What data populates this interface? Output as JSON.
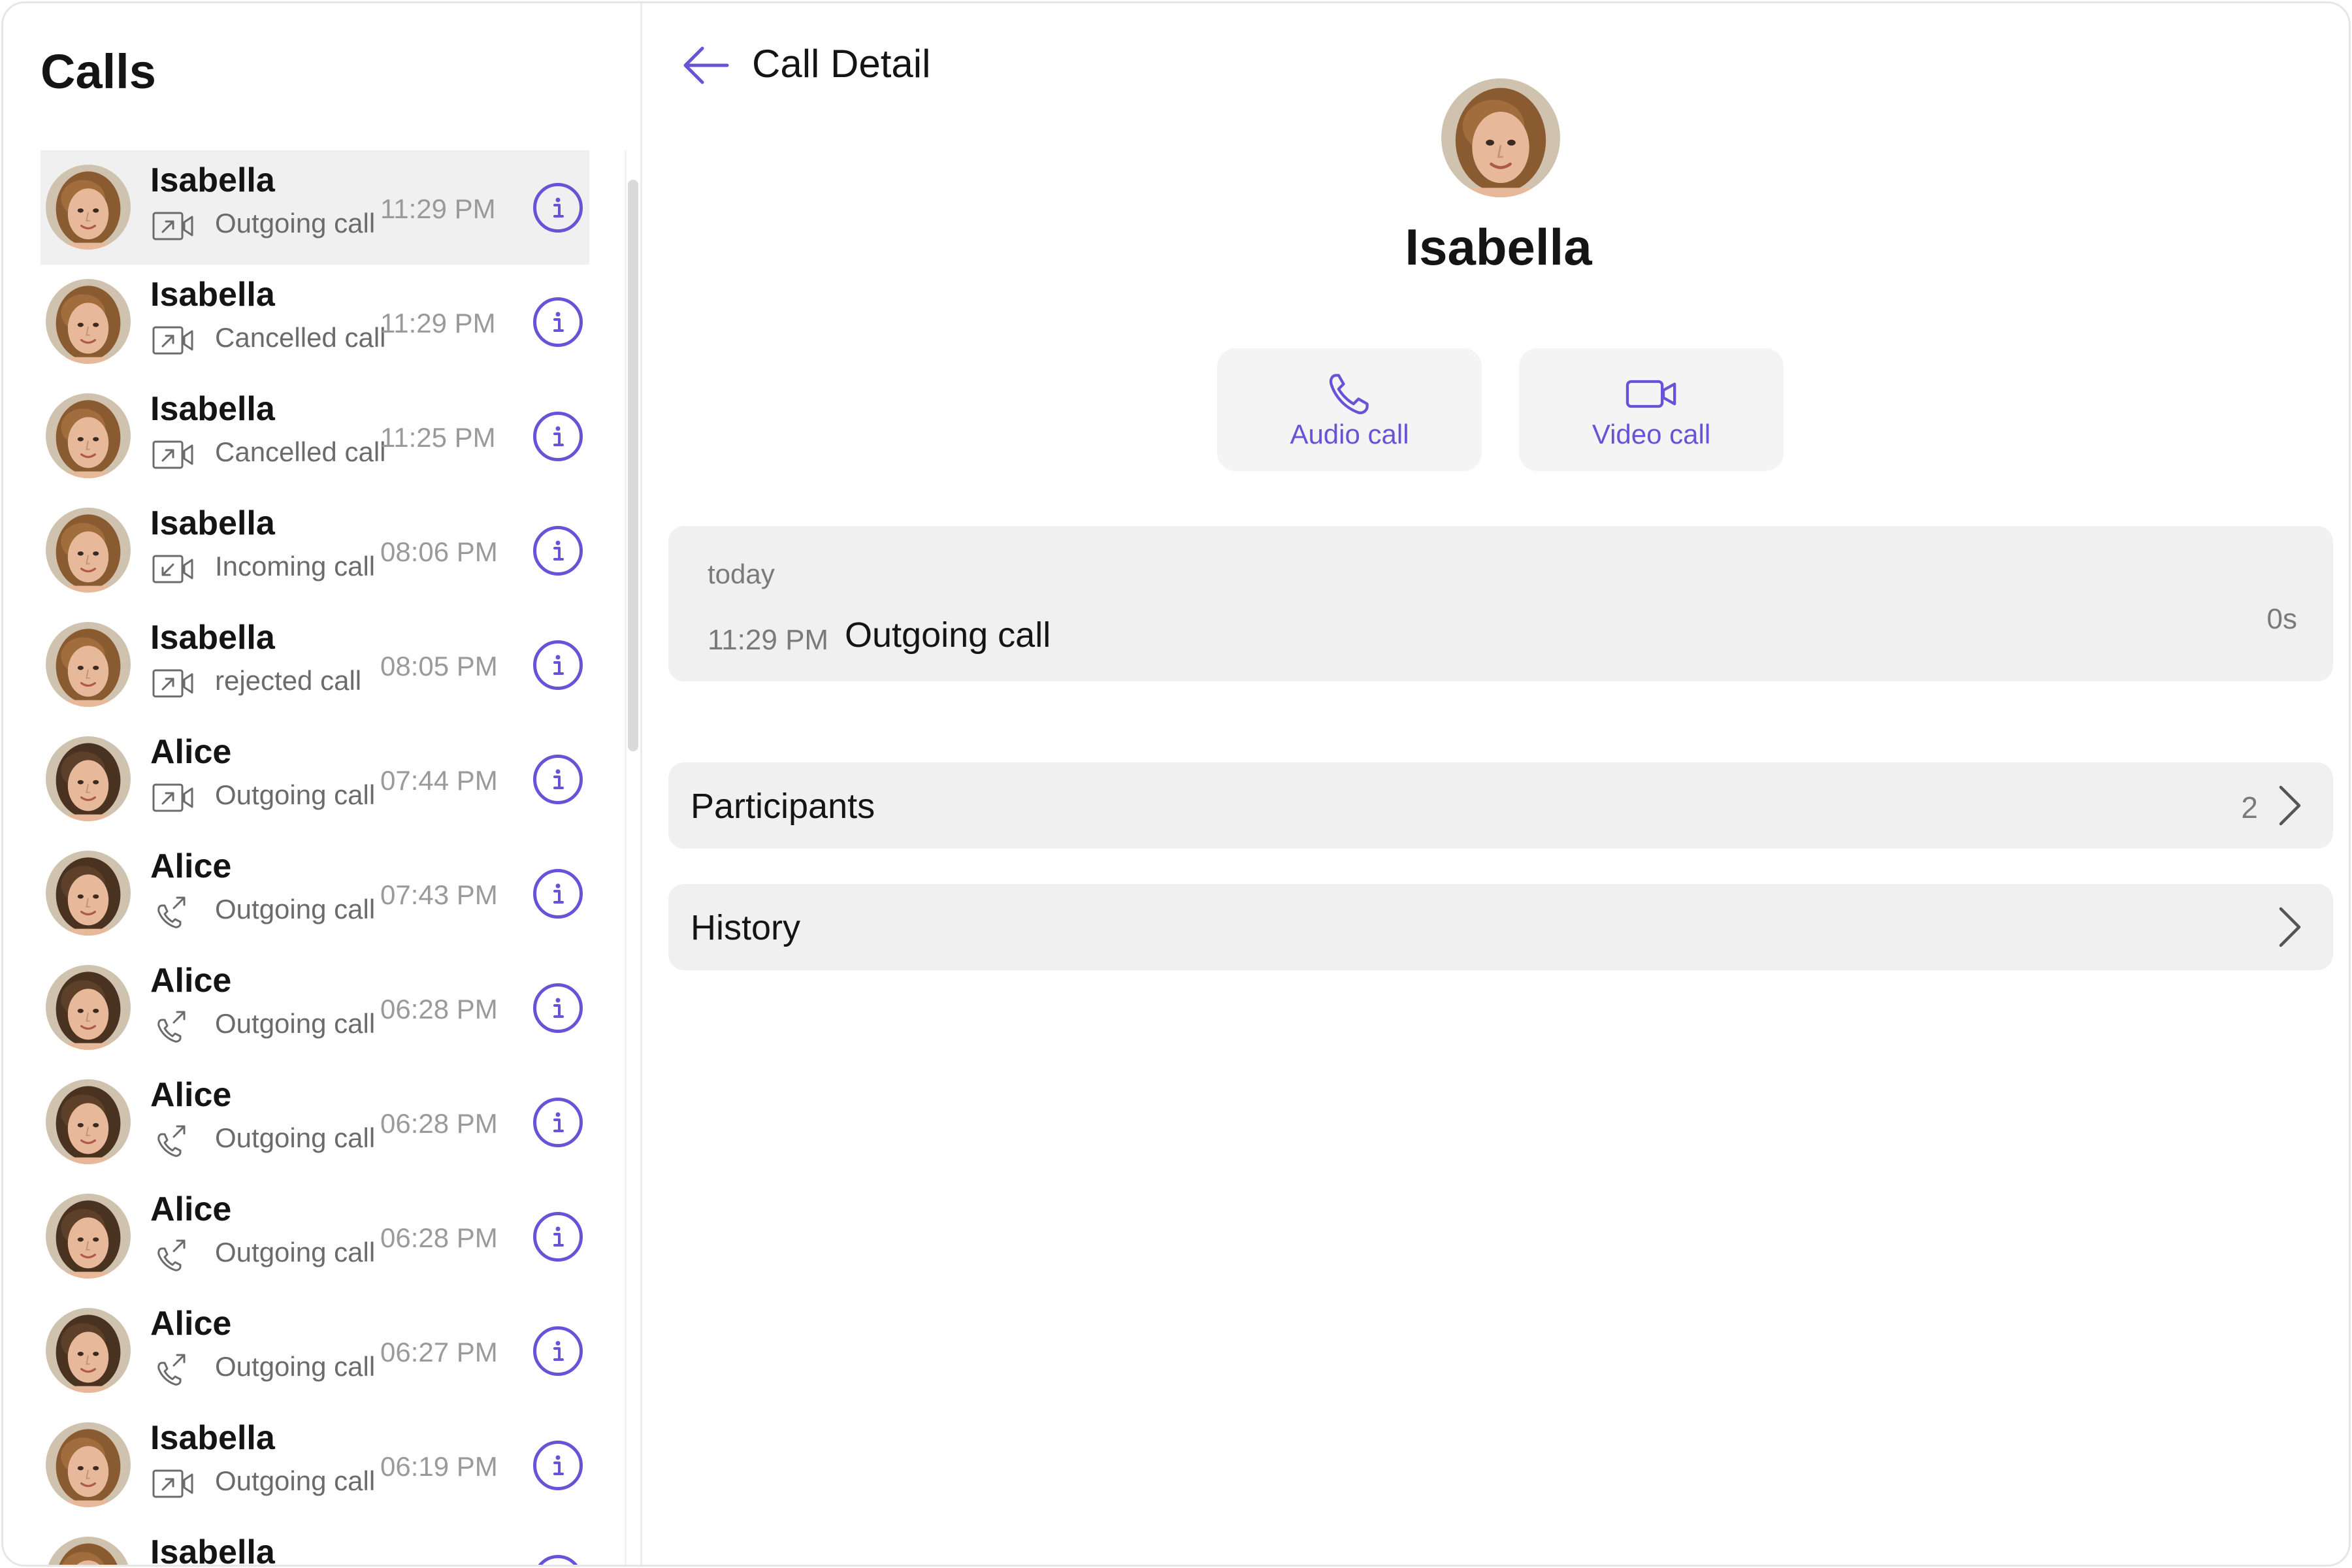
{
  "calls_panel": {
    "title": "Calls",
    "items": [
      {
        "name": "Isabella",
        "status": "Outgoing call",
        "time": "11:29 PM",
        "media": "video",
        "direction": "outgoing",
        "avatar": "isabella",
        "selected": true
      },
      {
        "name": "Isabella",
        "status": "Cancelled call",
        "time": "11:29 PM",
        "media": "video",
        "direction": "outgoing",
        "avatar": "isabella"
      },
      {
        "name": "Isabella",
        "status": "Cancelled call",
        "time": "11:25 PM",
        "media": "video",
        "direction": "outgoing",
        "avatar": "isabella"
      },
      {
        "name": "Isabella",
        "status": "Incoming call",
        "time": "08:06 PM",
        "media": "video",
        "direction": "incoming",
        "avatar": "isabella"
      },
      {
        "name": "Isabella",
        "status": "rejected call",
        "time": "08:05 PM",
        "media": "video",
        "direction": "outgoing",
        "avatar": "isabella"
      },
      {
        "name": "Alice",
        "status": "Outgoing call",
        "time": "07:44 PM",
        "media": "video",
        "direction": "outgoing",
        "avatar": "alice"
      },
      {
        "name": "Alice",
        "status": "Outgoing call",
        "time": "07:43 PM",
        "media": "audio",
        "direction": "outgoing",
        "avatar": "alice"
      },
      {
        "name": "Alice",
        "status": "Outgoing call",
        "time": "06:28 PM",
        "media": "audio",
        "direction": "outgoing",
        "avatar": "alice"
      },
      {
        "name": "Alice",
        "status": "Outgoing call",
        "time": "06:28 PM",
        "media": "audio",
        "direction": "outgoing",
        "avatar": "alice"
      },
      {
        "name": "Alice",
        "status": "Outgoing call",
        "time": "06:28 PM",
        "media": "audio",
        "direction": "outgoing",
        "avatar": "alice"
      },
      {
        "name": "Alice",
        "status": "Outgoing call",
        "time": "06:27 PM",
        "media": "audio",
        "direction": "outgoing",
        "avatar": "alice"
      },
      {
        "name": "Isabella",
        "status": "Outgoing call",
        "time": "06:19 PM",
        "media": "video",
        "direction": "outgoing",
        "avatar": "isabella"
      },
      {
        "name": "Isabella",
        "status": "",
        "time": "",
        "media": "video",
        "direction": "outgoing",
        "avatar": "isabella"
      }
    ]
  },
  "detail": {
    "title": "Call Detail",
    "name": "Isabella",
    "audio_label": "Audio call",
    "video_label": "Video call",
    "today": {
      "label": "today",
      "time": "11:29 PM",
      "type": "Outgoing call",
      "duration": "0s"
    },
    "participants_label": "Participants",
    "participants_count": "2",
    "history_label": "History"
  },
  "colors": {
    "accent": "#6852d6",
    "card_bg": "#f0f0f0",
    "muted_text": "#7a7a7a"
  },
  "icons": {
    "back": "arrow-left-icon",
    "info": "info-icon",
    "audio": "phone-icon",
    "video": "video-camera-icon",
    "chevron": "chevron-right-icon"
  }
}
